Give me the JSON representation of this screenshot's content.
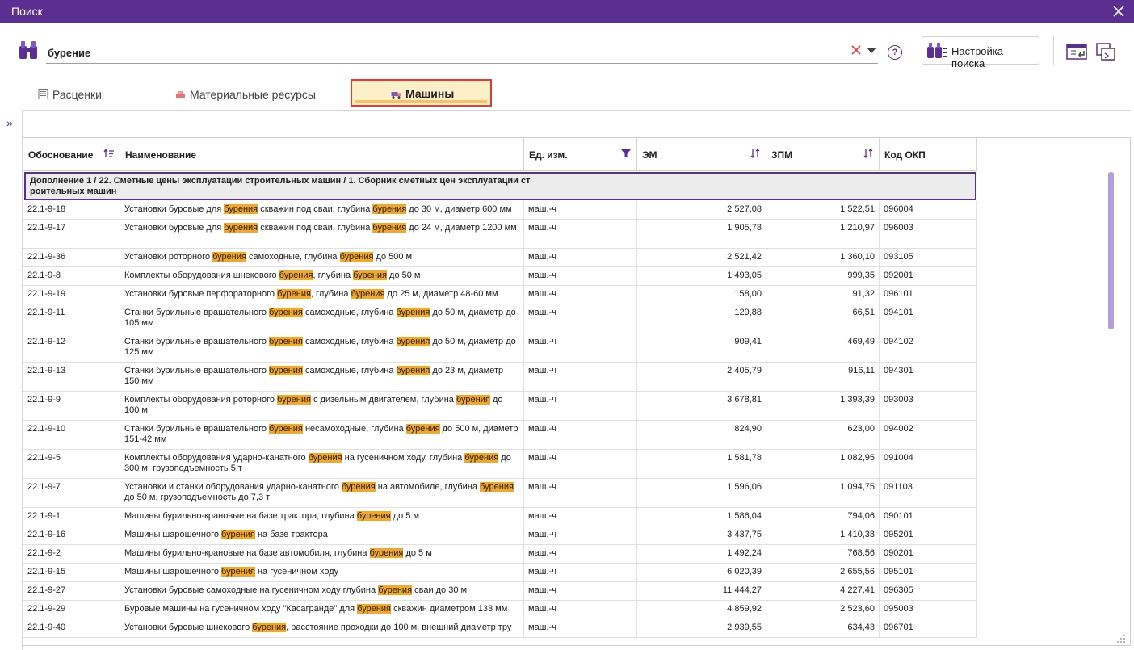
{
  "window": {
    "title": "Поиск"
  },
  "search": {
    "value": "бурение",
    "settings_label": "Настройка поиска",
    "help": "?"
  },
  "tabs": [
    {
      "label": "Расценки"
    },
    {
      "label": "Материальные ресурсы"
    },
    {
      "label": "Машины",
      "active": true
    }
  ],
  "grid": {
    "headers": [
      "Обоснование",
      "Наименование",
      "Ед. изм.",
      "ЭМ",
      "ЗПМ",
      "Код ОКП"
    ],
    "group": "Дополнение 1 / 22. Сметные цены эксплуатации строительных машин / 1. Сборник сметных цен эксплуатации строительных машин",
    "highlight_word": "бурения",
    "rows": [
      {
        "code": "22.1-9-18",
        "name": "Установки буровые для бурения скважин под сваи, глубина бурения до 30 м, диаметр 600 мм",
        "unit": "маш.-ч",
        "em": "2 527,08",
        "zpm": "1 522,51",
        "okp": "096004",
        "lines": 1
      },
      {
        "code": "22.1-9-17",
        "name": "Установки буровые для бурения скважин под сваи, глубина бурения до 24 м, диаметр 1200 мм",
        "unit": "маш.-ч",
        "em": "1 905,78",
        "zpm": "1 210,97",
        "okp": "096003",
        "lines": 2
      },
      {
        "code": "22.1-9-36",
        "name": "Установки роторного бурения самоходные, глубина бурения до 500 м",
        "unit": "маш.-ч",
        "em": "2 521,42",
        "zpm": "1 360,10",
        "okp": "093105",
        "lines": 1
      },
      {
        "code": "22.1-9-8",
        "name": "Комплекты оборудования шнекового бурения, глубина бурения до 50 м",
        "unit": "маш.-ч",
        "em": "1 493,05",
        "zpm": "999,35",
        "okp": "092001",
        "lines": 1
      },
      {
        "code": "22.1-9-19",
        "name": "Установки буровые перфораторного бурения, глубина бурения до 25 м, диаметр 48-60 мм",
        "unit": "маш.-ч",
        "em": "158,00",
        "zpm": "91,32",
        "okp": "096101",
        "lines": 1
      },
      {
        "code": "22.1-9-11",
        "name": "Станки бурильные вращательного бурения самоходные, глубина бурения до 50 м, диаметр до 105 мм",
        "unit": "маш.-ч",
        "em": "129,88",
        "zpm": "66,51",
        "okp": "094101",
        "lines": 2
      },
      {
        "code": "22.1-9-12",
        "name": "Станки бурильные вращательного бурения самоходные, глубина бурения до 50 м, диаметр до 125 мм",
        "unit": "маш.-ч",
        "em": "909,41",
        "zpm": "469,49",
        "okp": "094102",
        "lines": 2
      },
      {
        "code": "22.1-9-13",
        "name": "Станки бурильные вращательного бурения самоходные, глубина бурения до 23 м, диаметр 150 мм",
        "unit": "маш.-ч",
        "em": "2 405,79",
        "zpm": "916,11",
        "okp": "094301",
        "lines": 2
      },
      {
        "code": "22.1-9-9",
        "name": "Комплекты оборудования роторного бурения с дизельным двигателем, глубина бурения до 100 м",
        "unit": "маш.-ч",
        "em": "3 678,81",
        "zpm": "1 393,39",
        "okp": "093003",
        "lines": 2
      },
      {
        "code": "22.1-9-10",
        "name": "Станки бурильные вращательного бурения несамоходные, глубина бурения до 500 м, диаметр 151-42 мм",
        "unit": "маш.-ч",
        "em": "824,90",
        "zpm": "623,00",
        "okp": "094002",
        "lines": 2
      },
      {
        "code": "22.1-9-5",
        "name": "Комплекты оборудования ударно-канатного бурения на гусеничном ходу, глубина бурения до 300 м, грузоподъемность 5 т",
        "unit": "маш.-ч",
        "em": "1 581,78",
        "zpm": "1 082,95",
        "okp": "091004",
        "lines": 2
      },
      {
        "code": "22.1-9-7",
        "name": "Установки и станки оборудования ударно-канатного бурения на автомобиле, глубина бурения до 50 м, грузоподъемность до 7,3 т",
        "unit": "маш.-ч",
        "em": "1 596,06",
        "zpm": "1 094,75",
        "okp": "091103",
        "lines": 2
      },
      {
        "code": "22.1-9-1",
        "name": "Машины бурильно-крановые на базе трактора, глубина бурения до 5 м",
        "unit": "маш.-ч",
        "em": "1 586,04",
        "zpm": "794,06",
        "okp": "090101",
        "lines": 1
      },
      {
        "code": "22.1-9-16",
        "name": "Машины шарошечного бурения на базе трактора",
        "unit": "маш.-ч",
        "em": "3 437,75",
        "zpm": "1 410,38",
        "okp": "095201",
        "lines": 1
      },
      {
        "code": "22.1-9-2",
        "name": "Машины бурильно-крановые на базе автомобиля, глубина бурения до 5 м",
        "unit": "маш.-ч",
        "em": "1 492,24",
        "zpm": "768,56",
        "okp": "090201",
        "lines": 1
      },
      {
        "code": "22.1-9-15",
        "name": "Машины шарошечного бурения на гусеничном ходу",
        "unit": "маш.-ч",
        "em": "6 020,39",
        "zpm": "2 655,56",
        "okp": "095101",
        "lines": 1
      },
      {
        "code": "22.1-9-27",
        "name": "Установки буровые самоходные на гусеничном ходу глубина бурения сваи до 30 м",
        "unit": "маш.-ч",
        "em": "11 444,27",
        "zpm": "4 227,41",
        "okp": "096305",
        "lines": 1
      },
      {
        "code": "22.1-9-29",
        "name": "Буровые машины на гусеничном ходу \"Касагранде\" для бурения скважин диаметром 133 мм",
        "unit": "маш.-ч",
        "em": "4 859,92",
        "zpm": "2 523,60",
        "okp": "095003",
        "lines": 1
      },
      {
        "code": "22.1-9-40",
        "name": "Установки буровые шнекового бурения, расстояние проходки до 100 м, внешний диаметр тру",
        "unit": "маш.-ч",
        "em": "2 939,55",
        "zpm": "634,43",
        "okp": "096701",
        "lines": 1
      }
    ]
  },
  "colors": {
    "brand": "#5b2e91",
    "highlight": "#f7a823",
    "active_tab_border": "#e53935"
  }
}
